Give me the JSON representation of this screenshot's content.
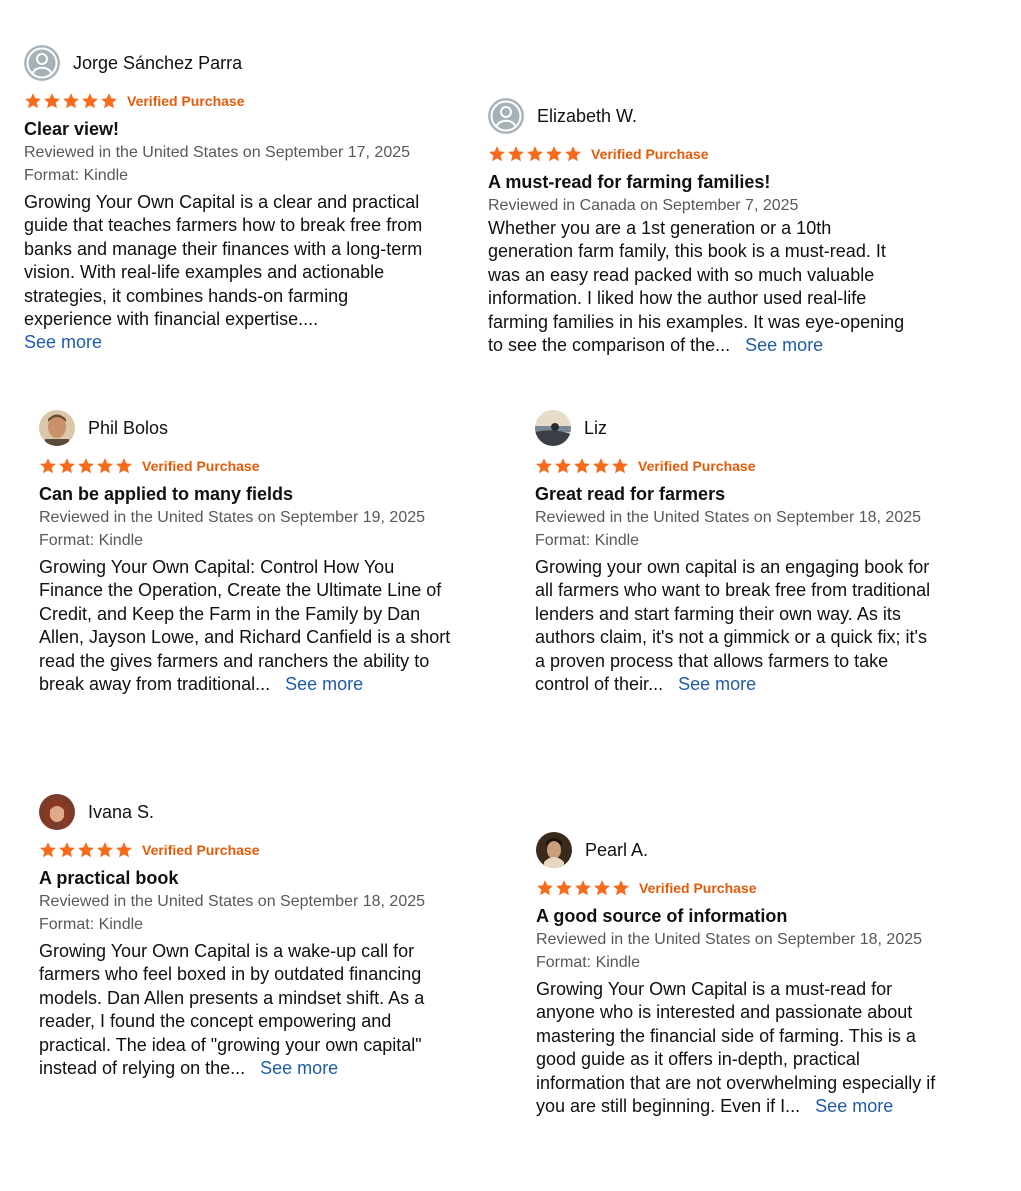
{
  "reviews": [
    {
      "name": "Jorge Sánchez Parra",
      "avatar": "default-avatar-icon",
      "verified": "Verified Purchase",
      "title": "Clear view!",
      "reviewed": "Reviewed in the United States on September 17, 2025",
      "format": "Format: Kindle",
      "body": "Growing Your Own Capital is a clear and practical guide that teaches farmers how to break free from banks and manage their finances with a long-term vision. With real-life examples and actionable strategies, it combines hands-on farming experience with financial expertise....",
      "see_more": "See more",
      "stars": 5
    },
    {
      "name": "Elizabeth W.",
      "avatar": "default-avatar-icon",
      "verified": "Verified Purchase",
      "title": "A must-read for farming families!",
      "reviewed": "Reviewed in Canada on September 7, 2025",
      "format": "",
      "body": "Whether you are a 1st generation or a 10th generation farm family, this book is a must-read. It was an easy read packed with so much valuable information. I liked how the author used real-life farming families in his examples. It was eye-opening to see the comparison of the...",
      "see_more": "See more",
      "stars": 5
    },
    {
      "name": "Phil Bolos",
      "avatar": "profile-photo",
      "verified": "Verified Purchase",
      "title": "Can be applied to many fields",
      "reviewed": "Reviewed in the United States on September 19, 2025",
      "format": "Format: Kindle",
      "body": "Growing Your Own Capital: Control How You Finance the Operation, Create the Ultimate Line of Credit, and Keep the Farm in the Family by Dan Allen, Jayson Lowe, and Richard Canfield is a short read the gives farmers and ranchers the ability to break away from traditional...",
      "see_more": "See more",
      "stars": 5
    },
    {
      "name": "Liz",
      "avatar": "profile-photo",
      "verified": "Verified Purchase",
      "title": "Great read for farmers",
      "reviewed": "Reviewed in the United States on September 18, 2025",
      "format": "Format: Kindle",
      "body": "Growing your own capital is an engaging book for all farmers who want to break free from traditional lenders and start farming their own way. As its authors claim, it's not a gimmick or a quick fix; it's a proven process that allows farmers to take control of their...",
      "see_more": "See more",
      "stars": 5
    },
    {
      "name": "Ivana S.",
      "avatar": "profile-photo",
      "verified": "Verified Purchase",
      "title": "A practical book",
      "reviewed": "Reviewed in the United States on September 18, 2025",
      "format": "Format: Kindle",
      "body": "Growing Your Own Capital is a wake-up call for farmers who feel boxed in by outdated financing models. Dan Allen presents a mindset shift. As a reader, I found the concept empowering and practical. The idea of \"growing your own capital\" instead of relying on the...",
      "see_more": "See more",
      "stars": 5
    },
    {
      "name": "Pearl A.",
      "avatar": "profile-photo",
      "verified": "Verified Purchase",
      "title": "A good source of information",
      "reviewed": "Reviewed in the United States on September 18, 2025",
      "format": "Format: Kindle",
      "body": "Growing Your Own Capital is a must-read for anyone who is interested and passionate about mastering the financial side of farming. This is a good guide as it offers in-depth, practical information that are not overwhelming especially if you are still beginning. Even if I...",
      "see_more": "See more",
      "stars": 5
    }
  ],
  "colors": {
    "star": "#f76b1c",
    "verified": "#e25b0a",
    "link": "#1f5ba8",
    "meta": "#565959"
  }
}
